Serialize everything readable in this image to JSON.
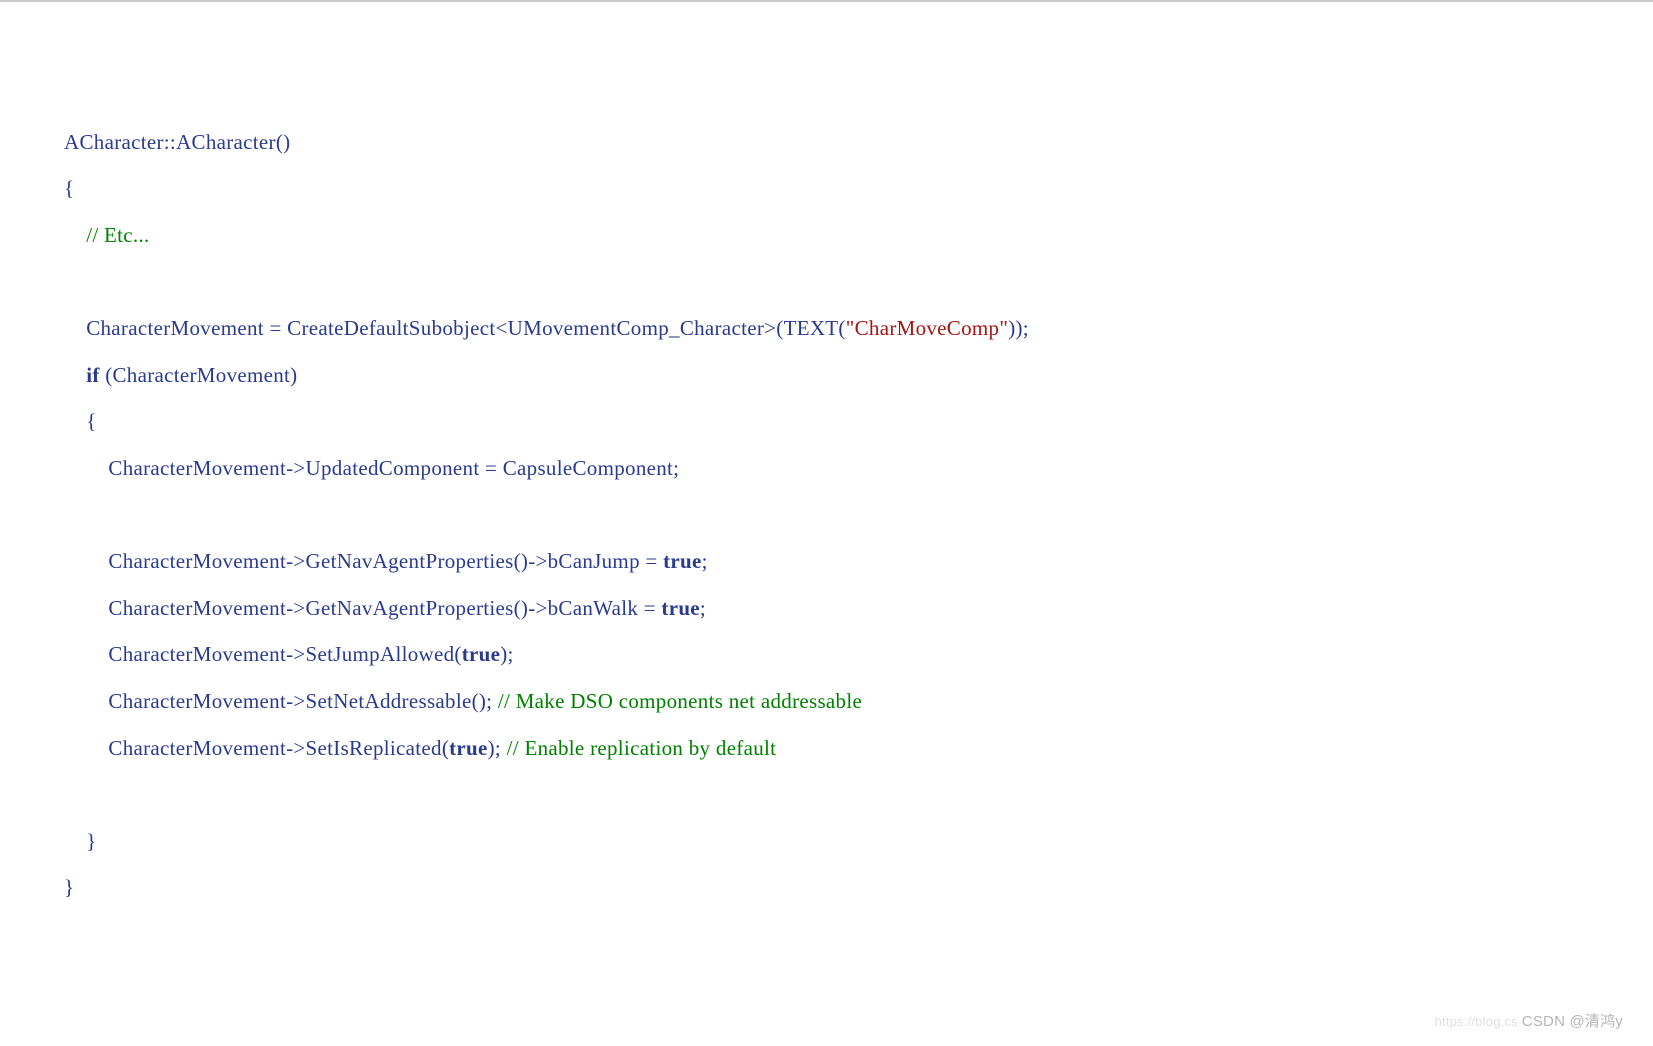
{
  "code": {
    "l1_class": "ACharacter",
    "l1_sep": "::",
    "l1_ctor": "ACharacter",
    "l1_parens": "()",
    "l2_brace": "{",
    "l3_indent": "    ",
    "l3_comment": "// Etc...",
    "l5_indent": "    ",
    "l5_a": "CharacterMovement = CreateDefaultSubobject<UMovementComp_Character>(TEXT(",
    "l5_str": "\"CharMoveComp\"",
    "l5_b": "));",
    "l6_indent": "    ",
    "l6_if": "if",
    "l6_cond": " (CharacterMovement)",
    "l7_indent": "    ",
    "l7_brace": "{",
    "l8_indent": "        ",
    "l8_text": "CharacterMovement->UpdatedComponent = CapsuleComponent;",
    "l10_indent": "        ",
    "l10_a": "CharacterMovement->GetNavAgentProperties()->bCanJump = ",
    "l10_true": "true",
    "l10_b": ";",
    "l11_indent": "        ",
    "l11_a": "CharacterMovement->GetNavAgentProperties()->bCanWalk = ",
    "l11_true": "true",
    "l11_b": ";",
    "l12_indent": "        ",
    "l12_a": "CharacterMovement->SetJumpAllowed(",
    "l12_true": "true",
    "l12_b": ");",
    "l13_indent": "        ",
    "l13_a": "CharacterMovement->SetNetAddressable(); ",
    "l13_comment": "// Make DSO components net addressable",
    "l14_indent": "        ",
    "l14_a": "CharacterMovement->SetIsReplicated(",
    "l14_true": "true",
    "l14_b": "); ",
    "l14_comment": "// Enable replication by default",
    "l16_indent": "    ",
    "l16_brace": "}",
    "l17_brace": "}"
  },
  "watermark": {
    "faint": "https://blog.cs",
    "text": "CSDN @清鸿y"
  }
}
